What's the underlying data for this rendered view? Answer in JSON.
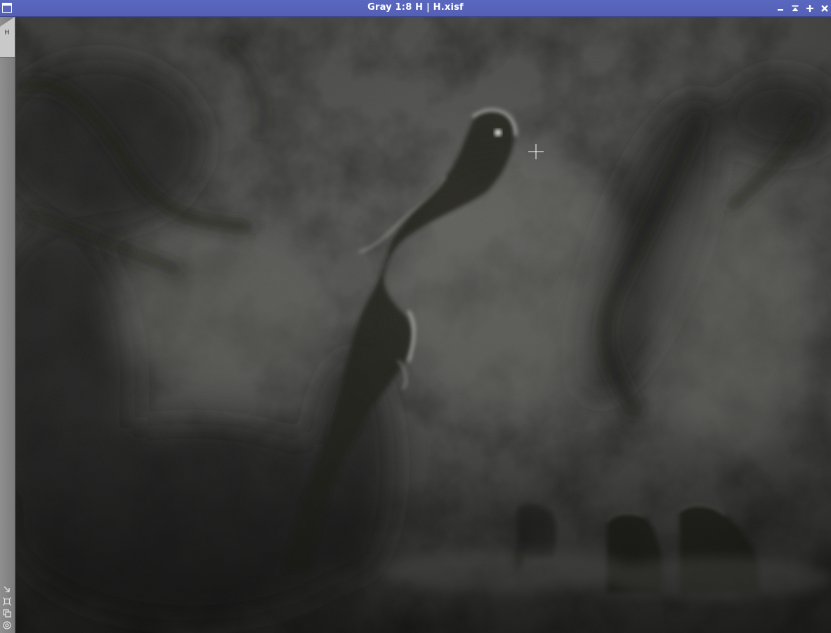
{
  "window": {
    "title": "Gray 1:8 H | H.xisf"
  },
  "view_tab": {
    "label": "H"
  },
  "colors": {
    "titlebar": "#5a67bf",
    "title_text": "#ffffff",
    "strip": "#8a8a8a",
    "tab": "#c9c9c9"
  },
  "icons": {
    "window": "window-icon",
    "minimize": "minimize-icon",
    "shade": "shade-icon",
    "maximize": "maximize-icon",
    "close": "close-icon",
    "tools": [
      "resize-arrow-icon",
      "fit-view-icon",
      "duplicate-icon",
      "target-icon"
    ]
  }
}
